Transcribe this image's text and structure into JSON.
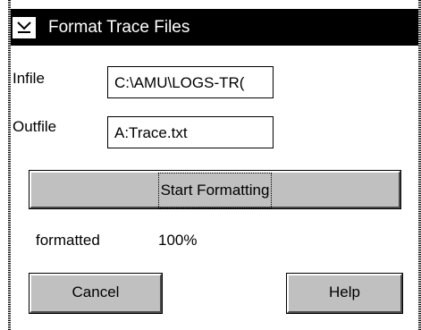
{
  "window": {
    "title": "Format Trace Files"
  },
  "form": {
    "infile_label": "Infile",
    "infile_value": "C:\\AMU\\LOGS-TR(",
    "outfile_label": "Outfile",
    "outfile_value": "A:Trace.txt"
  },
  "actions": {
    "start_label": "Start Formatting",
    "cancel_label": "Cancel",
    "help_label": "Help"
  },
  "status": {
    "label": "formatted",
    "value": "100%"
  },
  "icons": {
    "system_menu": "system-menu-icon"
  }
}
